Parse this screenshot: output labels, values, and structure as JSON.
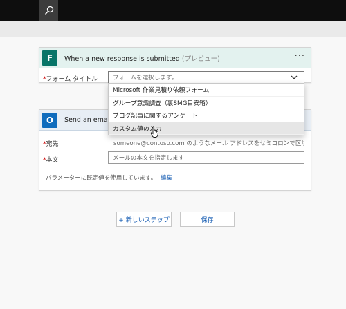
{
  "topbar": {
    "search_icon": "search-icon"
  },
  "trigger": {
    "title": "When a new response is submitted",
    "title_suffix": "(プレビュー)",
    "more_icon": "ellipsis-icon",
    "form_label": "フォーム タイトル",
    "form_placeholder": "フォームを選択します。",
    "dropdown_options": [
      "Microsoft 作業見積り依頼フォーム",
      "グループ意識調査（裏SMG目安箱）",
      "ブログ記事に関するアンケート",
      "カスタム値の入力"
    ],
    "accent": "#077568"
  },
  "action": {
    "title": "Send an email",
    "to_label": "宛先",
    "to_placeholder": "someone@contoso.com のようなメール アドレスをセミコロンで区切って...",
    "body_label": "本文",
    "body_placeholder": "メールの本文を指定します",
    "note": "パラメーターに既定値を使用しています。",
    "edit_link": "編集",
    "accent": "#0f6cbd"
  },
  "buttons": {
    "new_step": "+ 新しいステップ",
    "save": "保存"
  }
}
